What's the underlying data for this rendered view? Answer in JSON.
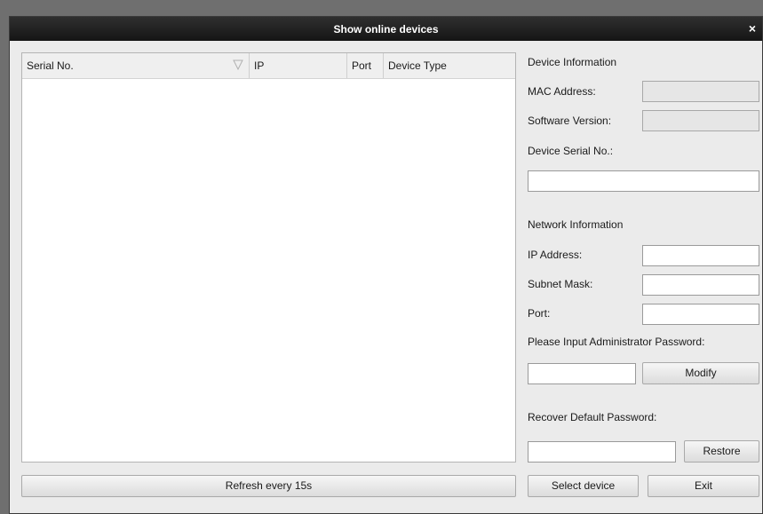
{
  "dialog": {
    "title": "Show online devices",
    "close_glyph": "×"
  },
  "device_list": {
    "columns": [
      "Serial No.",
      "IP",
      "Port",
      "Device Type"
    ],
    "sort_icon": "sort-triangle-icon",
    "rows": []
  },
  "refresh_button": "Refresh every 15s",
  "device_info": {
    "heading": "Device Information",
    "mac_label": "MAC Address:",
    "mac_value": "",
    "software_label": "Software Version:",
    "software_value": "",
    "serial_label": "Device Serial No.:",
    "serial_value": ""
  },
  "network_info": {
    "heading": "Network Information",
    "ip_label": "IP Address:",
    "ip_value": "",
    "mask_label": "Subnet Mask:",
    "mask_value": "",
    "port_label": "Port:",
    "port_value": ""
  },
  "admin": {
    "label": "Please Input Administrator Password:",
    "password_value": "",
    "modify_button": "Modify"
  },
  "recover": {
    "label": "Recover Default Password:",
    "value": "",
    "restore_button": "Restore"
  },
  "footer": {
    "select_button": "Select device",
    "exit_button": "Exit"
  }
}
